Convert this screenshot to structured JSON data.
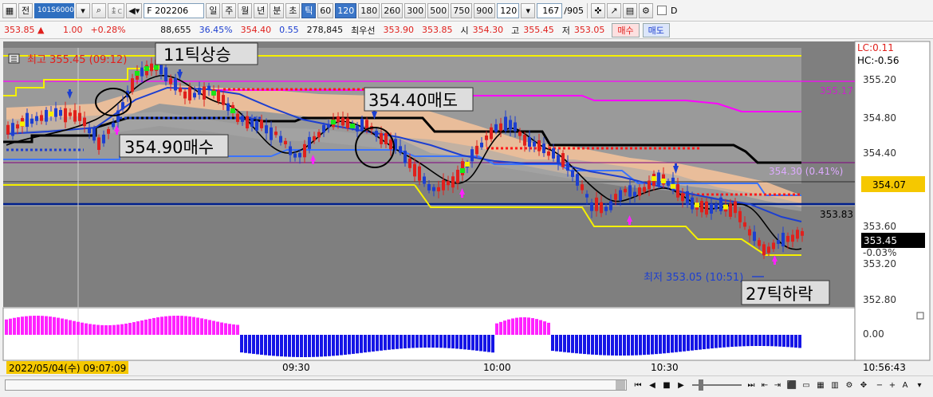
{
  "toolbar": {
    "tab_label": "전",
    "code": "101S6000",
    "search_icon": "magnifier-icon",
    "futures_name": "F 202206",
    "periods": [
      "일",
      "주",
      "월",
      "년",
      "분",
      "초",
      "틱"
    ],
    "active_period": "틱",
    "tick_options": [
      "60",
      "120",
      "180",
      "260",
      "300",
      "500",
      "750",
      "900"
    ],
    "active_tick": "120",
    "tick_select": "120",
    "count": "167",
    "total": "/905",
    "checkbox_label": "D"
  },
  "quote": {
    "price": "353.85",
    "change": "1.00",
    "change_pct": "+0.28%",
    "volume": "88,655",
    "vol_pct": "36.45%",
    "theory": "354.40",
    "basis": "0.55",
    "open_interest": "278,845",
    "best_label": "최우선",
    "best_ask": "353.90",
    "best_bid": "353.85",
    "open_label": "시",
    "open": "354.30",
    "high_label": "고",
    "high": "355.45",
    "low_label": "저",
    "low": "353.05",
    "buy_label": "매수",
    "sell_label": "매도"
  },
  "chart": {
    "high_note": "최고 355.45 (09:12)",
    "low_note": "최저 353.05 (10:51)",
    "ann_up11": "11틱상승",
    "ann_sell": "354.40매도",
    "ann_buy": "354.90매수",
    "ann_down27": "27틱하락",
    "lc": "LC:0.11",
    "hc": "HC:-0.56",
    "y_ticks": [
      "355.20",
      "354.80",
      "354.40",
      "353.60",
      "353.20",
      "352.80"
    ],
    "level_355_17": "355.17",
    "level_354_30": "354.30 (0.41%)",
    "level_354_07": "354.07",
    "level_353_83": "353.83",
    "current_price": "353.45",
    "current_pct": "-0.03%",
    "osc_zero": "0.00",
    "time_labels": [
      "09:30",
      "10:00",
      "10:30"
    ],
    "cursor_time": "2022/05/04(수) 09:07:09",
    "clock": "10:56:43"
  },
  "colors": {
    "up": "#e0201c",
    "down": "#1d3fd0",
    "yellow": "#f5f000",
    "magenta": "#ff00ff",
    "navy": "#001f8c"
  }
}
